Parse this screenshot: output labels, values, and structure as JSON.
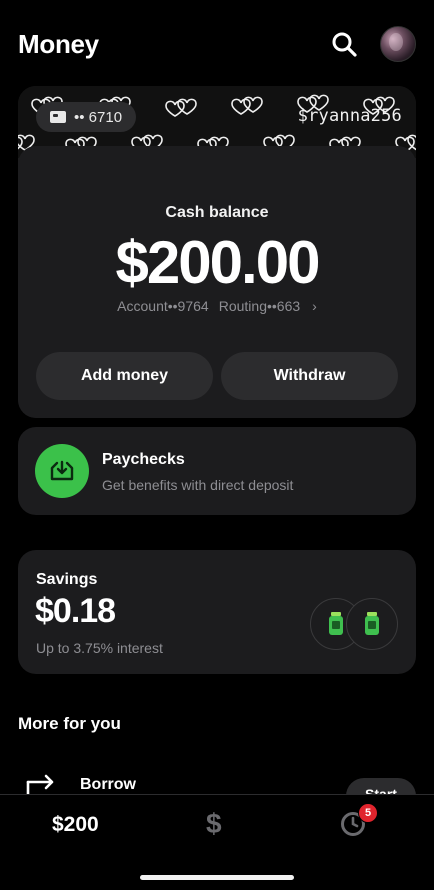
{
  "header": {
    "title": "Money"
  },
  "card": {
    "number": "•• 6710",
    "cashtag": "$ryanna256"
  },
  "balance": {
    "label": "Cash balance",
    "value": "$200.00",
    "account": "Account••9764",
    "routing": "Routing••663"
  },
  "actions": {
    "add_money": "Add money",
    "withdraw": "Withdraw"
  },
  "paychecks": {
    "title": "Paychecks",
    "subtitle": "Get benefits with direct deposit"
  },
  "savings": {
    "title": "Savings",
    "value": "$0.18",
    "subtitle": "Up to 3.75% interest"
  },
  "more": {
    "title": "More for you",
    "borrow_label": "Borrow",
    "borrow_button": "Start"
  },
  "nav": {
    "balance": "$200",
    "dollar": "$",
    "activity_badge": "5"
  },
  "colors": {
    "paychecks_green": "#3bc14a",
    "badge_red": "#e0242d",
    "card_bg": "#1c1c1e"
  }
}
